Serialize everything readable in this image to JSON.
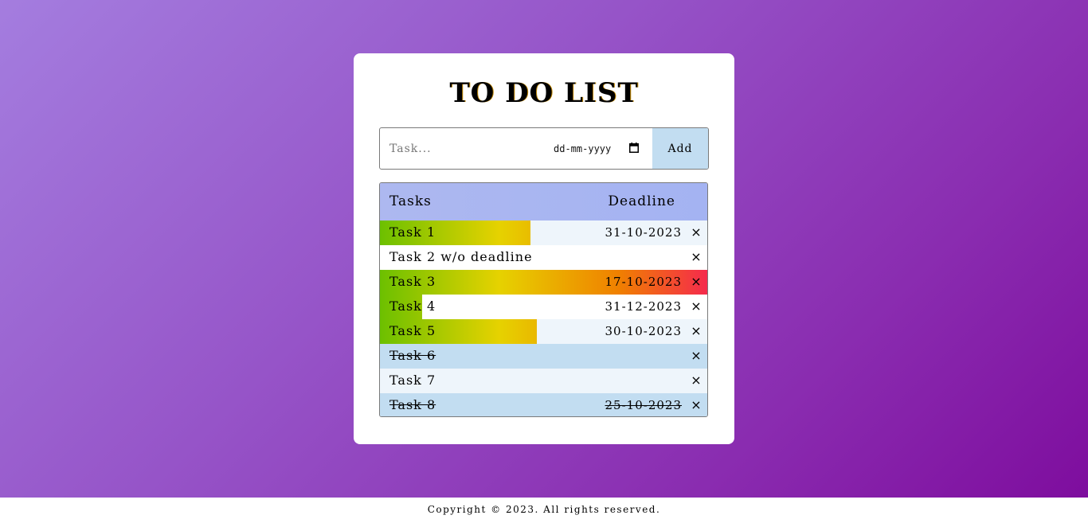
{
  "app": {
    "title": "TO DO LIST"
  },
  "form": {
    "task_placeholder": "Task...",
    "task_value": "",
    "date_placeholder": "dd-mm-yyyy",
    "add_label": "Add"
  },
  "table": {
    "header_tasks": "Tasks",
    "header_deadline": "Deadline",
    "rows": [
      {
        "name": "Task 1",
        "deadline": "31-10-2023",
        "delete": "×",
        "done": false,
        "elapsed_fraction": 0.46,
        "background": "#eef5fb"
      },
      {
        "name": "Task 2 w/o deadline",
        "deadline": "",
        "delete": "×",
        "done": false,
        "elapsed_fraction": 0,
        "background": "#ffffff"
      },
      {
        "name": "Task 3",
        "deadline": "17-10-2023",
        "delete": "×",
        "done": false,
        "elapsed_fraction": 1.0,
        "background": "#eef5fb"
      },
      {
        "name": "Task 4",
        "deadline": "31-12-2023",
        "delete": "×",
        "done": false,
        "elapsed_fraction": 0.13,
        "background": "#ffffff"
      },
      {
        "name": "Task 5",
        "deadline": "30-10-2023",
        "delete": "×",
        "done": false,
        "elapsed_fraction": 0.48,
        "background": "#eef5fb"
      },
      {
        "name": "Task 6",
        "deadline": "",
        "delete": "×",
        "done": true,
        "elapsed_fraction": 0,
        "background": "#c2ddf1"
      },
      {
        "name": "Task 7",
        "deadline": "",
        "delete": "×",
        "done": false,
        "elapsed_fraction": 0,
        "background": "#eef5fb"
      },
      {
        "name": "Task 8",
        "deadline": "25-10-2023",
        "delete": "×",
        "done": true,
        "elapsed_fraction": 0,
        "background": "#c2ddf1"
      }
    ]
  },
  "footer": {
    "copyright": "Copyright © 2023. All rights reserved."
  },
  "colors": {
    "progress_start": "#6cc000",
    "progress_mid": "#e6d200",
    "progress_orange": "#f08000",
    "progress_end": "#f52a4c",
    "add_button": "#c2ddf1",
    "header_bg": "#a8b6f1"
  },
  "icons": {
    "date_picker": "calendar-icon",
    "delete": "close-icon"
  }
}
